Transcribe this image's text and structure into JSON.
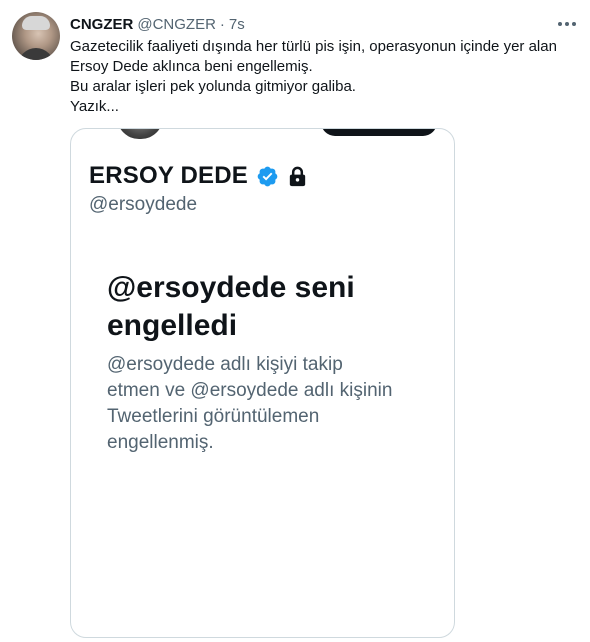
{
  "tweet": {
    "author_name": "CNGZER",
    "author_handle": "@CNGZER",
    "separator": "·",
    "time": "7s",
    "text_lines": [
      "Gazetecilik faaliyeti dışında her türlü pis işin, operasyonun içinde yer alan",
      "Ersoy Dede aklınca beni engellemiş.",
      "Bu aralar işleri pek yolunda gitmiyor galiba.",
      "Yazık..."
    ]
  },
  "media": {
    "profile_name": "ERSOY DEDE",
    "profile_handle": "@ersoydede",
    "blocked_title_lines": [
      "@ersoydede seni",
      "engelledi"
    ],
    "blocked_desc_lines": [
      "@ersoydede adlı kişiyi takip",
      "etmen ve @ersoydede adlı kişinin",
      "Tweetlerini görüntülemen",
      "engellenmiş."
    ]
  },
  "icons": {
    "more": "more-horizontal-icon",
    "verified": "verified-badge-icon",
    "lock": "lock-icon"
  },
  "colors": {
    "text_primary": "#0f1419",
    "text_secondary": "#536471",
    "verified_blue": "#1d9bf0",
    "border": "#cfd9de"
  }
}
